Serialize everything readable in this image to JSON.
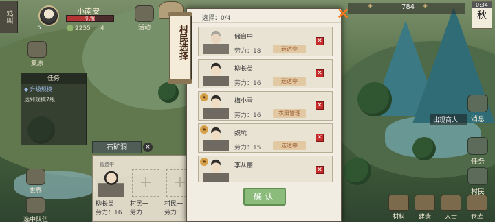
{
  "player": {
    "side_tag": "鸡叫",
    "level": "5",
    "name": "小南安",
    "status": "饥饿",
    "coins": "2255",
    "gems": "4"
  },
  "topbar": {
    "resource": "784",
    "time": "0:34",
    "season": "秋"
  },
  "left_menu": {
    "activity": "活动",
    "recover": "复原",
    "world": "世界",
    "team": "选中队伍"
  },
  "tasks": {
    "title": "任务",
    "line1": "◆ 升级规模",
    "line2": "达到规模7级"
  },
  "mine": {
    "title": "石矿洞",
    "close": "×",
    "slot1_tag": "锻造中",
    "slot1_name": "柳长英",
    "slot1_labor": "劳力：16",
    "slot2_name": "村民一",
    "slot2_labor": "劳力一",
    "slot3_name": "村民一",
    "slot3_labor": "劳力一",
    "plus": "+"
  },
  "right_menu": {
    "seller": "出现商人",
    "message": "消息",
    "task": "任务",
    "villager": "村民",
    "material": "材料",
    "build": "建造",
    "person": "人士",
    "warehouse": "仓库"
  },
  "dialog": {
    "scroll_title": "村民选择",
    "counter": "选择：0/4",
    "close": "×",
    "confirm": "确认",
    "villagers": [
      {
        "name": "储自中",
        "labor": "劳力：18",
        "status": "送达中",
        "star": ""
      },
      {
        "name": "柳长英",
        "labor": "劳力：16",
        "status": "送达中",
        "star": ""
      },
      {
        "name": "梅小雪",
        "labor": "劳力：16",
        "status": "农田管理",
        "star": "★"
      },
      {
        "name": "魏坑",
        "labor": "劳力：15",
        "status": "送达中",
        "star": "★"
      },
      {
        "name": "李从丽",
        "labor": "",
        "status": "",
        "star": "★"
      }
    ]
  }
}
